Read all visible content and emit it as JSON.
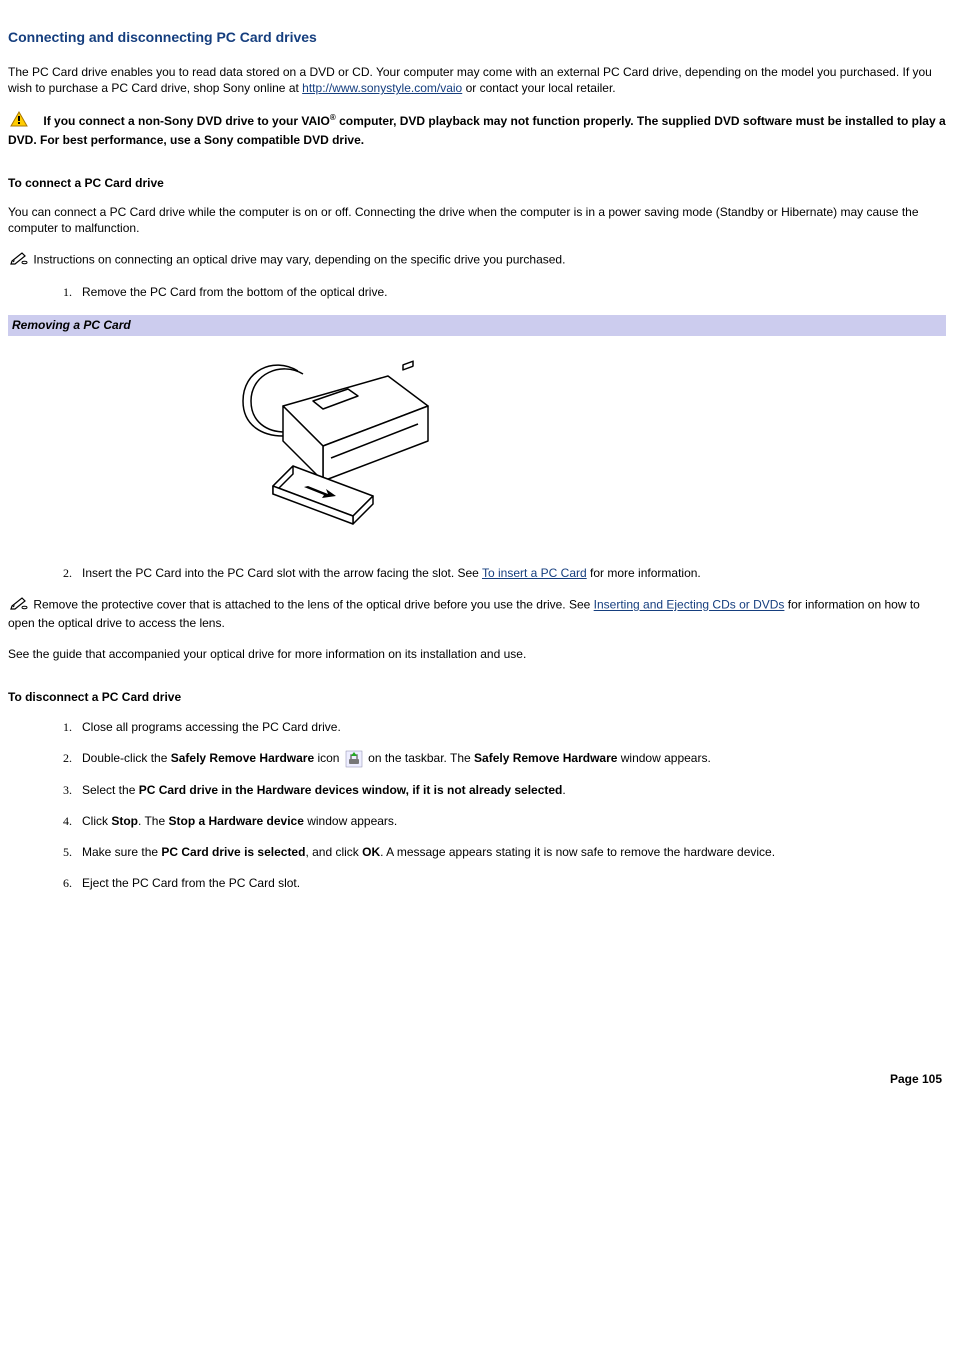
{
  "title": "Connecting and disconnecting PC Card drives",
  "intro": {
    "p1a": "The PC Card drive enables you to read data stored on a DVD or CD. Your computer may come with an external PC Card drive, depending on the model you purchased. If you wish to purchase a PC Card drive, shop Sony online at ",
    "link": "http://www.sonystyle.com/vaio",
    "p1b": " or contact your local retailer."
  },
  "warning": {
    "t1": "If you connect a non-Sony DVD drive to your VAIO",
    "reg": "®",
    "t2": " computer, DVD playback may not function properly. The supplied DVD software must be installed to play a DVD. For best performance, use a Sony compatible DVD drive."
  },
  "connect": {
    "heading": "To connect a PC Card drive",
    "p1": "You can connect a PC Card drive while the computer is on or off. Connecting the drive when the computer is in a power saving mode (Standby or Hibernate) may cause the computer to malfunction.",
    "note1": "Instructions on connecting an optical drive may vary, depending on the specific drive you purchased.",
    "step1": "Remove the PC Card from the bottom of the optical drive.",
    "caption": "Removing a PC Card",
    "step2a": "Insert the PC Card into the PC Card slot with the arrow facing the slot. See ",
    "step2link": "To insert a PC Card",
    "step2b": " for more information.",
    "note2a": "Remove the protective cover that is attached to the lens of the optical drive before you use the drive. See ",
    "note2link": "Inserting and Ejecting CDs or DVDs",
    "note2b": " for information on how to open the optical drive to access the lens.",
    "p3": "See the guide that accompanied your optical drive for more information on its installation and use."
  },
  "disconnect": {
    "heading": "To disconnect a PC Card drive",
    "s1": "Close all programs accessing the PC Card drive.",
    "s2a": "Double-click the ",
    "s2b": "Safely Remove Hardware",
    "s2c": " icon ",
    "s2d": " on the taskbar. The ",
    "s2e": "Safely Remove Hardware",
    "s2f": " window appears.",
    "s3a": "Select the ",
    "s3b": "PC Card drive in the Hardware devices window, if it is not already selected",
    "s3c": ".",
    "s4a": "Click ",
    "s4b": "Stop",
    "s4c": ". The ",
    "s4d": "Stop a Hardware device",
    "s4e": " window appears.",
    "s5a": "Make sure the ",
    "s5b": "PC Card drive is selected",
    "s5c": ", and click ",
    "s5d": "OK",
    "s5e": ". A message appears stating it is now safe to remove the hardware device.",
    "s6": "Eject the PC Card from the PC Card slot."
  },
  "footer": "Page 105"
}
